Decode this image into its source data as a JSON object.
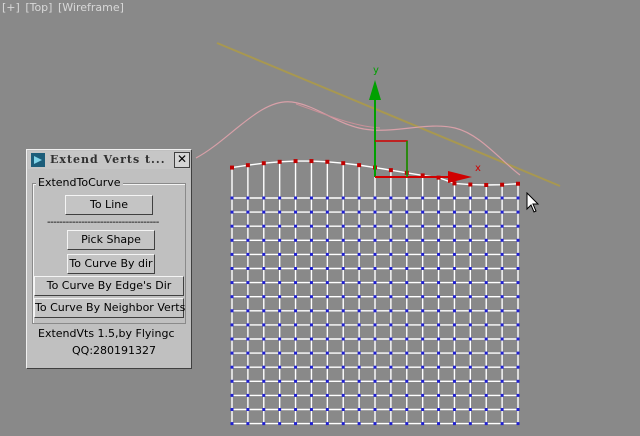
{
  "viewport": {
    "labels": [
      "[+]",
      "[Top]",
      "[Wireframe]"
    ],
    "axis_x": "x",
    "axis_y": "y"
  },
  "panel": {
    "title": "Extend Verts t...",
    "close_label": "✕",
    "group_label": "ExtendToCurve",
    "separator": "------------------------------------",
    "buttons": {
      "to_line": "To Line",
      "pick_shape": "Pick Shape",
      "to_curve_by_dir": "To Curve By dir",
      "to_curve_by_edges_dir": "To Curve By Edge's Dir",
      "to_curve_by_neighbor_verts": "To Curve By Neighbor Verts"
    },
    "footer_line1": "ExtendVts 1.5,by Flyingc",
    "footer_line2": "QQ:280191327"
  },
  "colors": {
    "viewport_bg": "#898989",
    "grid_lines": "#ffffff",
    "grid_vertices": "#2020d0",
    "curve_vertices": "#c00000",
    "gizmo_y": "#00a000",
    "gizmo_x": "#d00000",
    "guide_line": "#a89850",
    "pink_curve": "#d8a0a8"
  }
}
